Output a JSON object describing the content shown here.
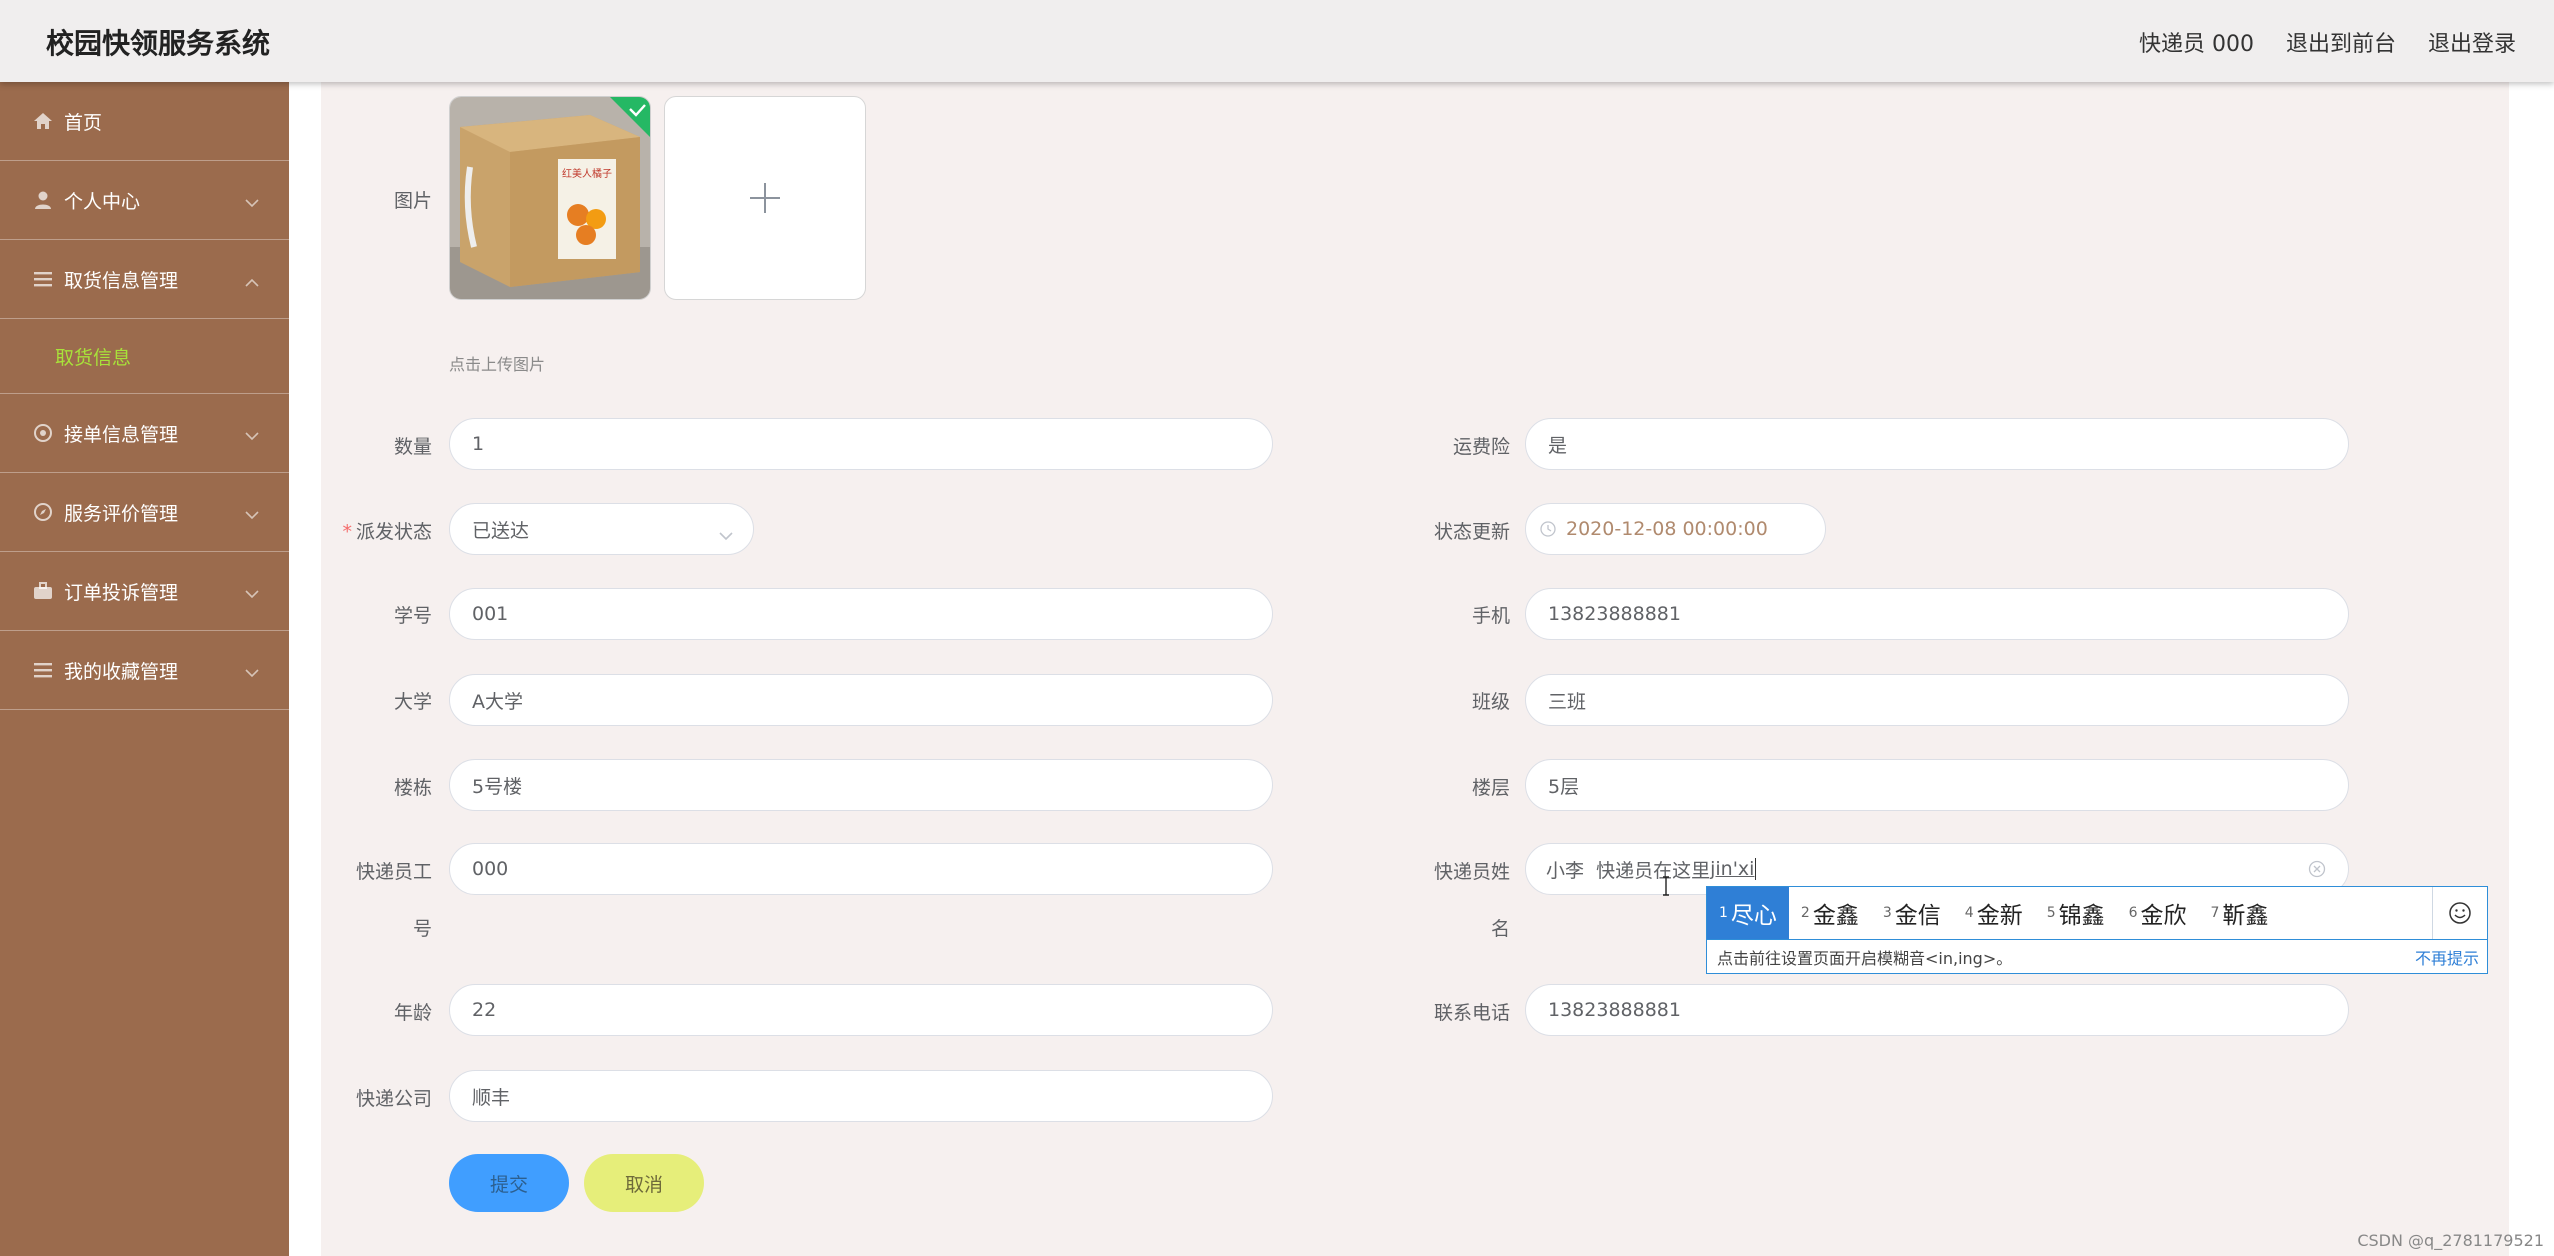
{
  "header": {
    "title": "校园快领服务系统",
    "user_label": "快递员 000",
    "to_front": "退出到前台",
    "logout": "退出登录"
  },
  "sidebar": {
    "items": [
      {
        "label": "首页",
        "icon": "home-icon",
        "expandable": false
      },
      {
        "label": "个人中心",
        "icon": "user-icon",
        "expandable": true
      },
      {
        "label": "取货信息管理",
        "icon": "menu-icon",
        "expandable": true,
        "expanded": true
      },
      {
        "label": "接单信息管理",
        "icon": "gear-icon",
        "expandable": true
      },
      {
        "label": "服务评价管理",
        "icon": "compass-icon",
        "expandable": true
      },
      {
        "label": "订单投诉管理",
        "icon": "briefcase-icon",
        "expandable": true
      },
      {
        "label": "我的收藏管理",
        "icon": "menu-icon",
        "expandable": true
      }
    ],
    "submenu_active": "取货信息",
    "active_color": "#a8e23a"
  },
  "form": {
    "image_label": "图片",
    "upload_tip": "点击上传图片",
    "fields": {
      "quantity": {
        "label": "数量",
        "value": "1"
      },
      "insurance": {
        "label": "运费险",
        "value": "是"
      },
      "status": {
        "label": "派发状态",
        "value": "已送达",
        "required": true
      },
      "status_update": {
        "label": "状态更新",
        "value": "2020-12-08 00:00:00"
      },
      "student_no": {
        "label": "学号",
        "value": "001"
      },
      "phone": {
        "label": "手机",
        "value": "13823888881"
      },
      "university": {
        "label": "大学",
        "value": "A大学"
      },
      "class": {
        "label": "班级",
        "value": "三班"
      },
      "building": {
        "label": "楼栋",
        "value": "5号楼"
      },
      "floor": {
        "label": "楼层",
        "value": "5层"
      },
      "courier_id": {
        "label_1": "快递员工",
        "label_2": "号",
        "value": "000"
      },
      "courier_name": {
        "label_1": "快递员姓",
        "label_2": "名",
        "value": "小李  快递员在这里",
        "composing": "jin'xi"
      },
      "age": {
        "label": "年龄",
        "value": "22"
      },
      "contact": {
        "label": "联系电话",
        "value": "13823888881"
      },
      "company": {
        "label": "快递公司",
        "value": "顺丰"
      }
    },
    "submit": "提交",
    "cancel": "取消"
  },
  "ime": {
    "candidates": [
      {
        "n": "1",
        "text": "尽心"
      },
      {
        "n": "2",
        "text": "金鑫"
      },
      {
        "n": "3",
        "text": "金信"
      },
      {
        "n": "4",
        "text": "金新"
      },
      {
        "n": "5",
        "text": "锦鑫"
      },
      {
        "n": "6",
        "text": "金欣"
      },
      {
        "n": "7",
        "text": "靳鑫"
      }
    ],
    "hint": "点击前往设置页面开启模糊音<in,ing>。",
    "no_hint": "不再提示"
  },
  "colors": {
    "sidebar_bg": "#9b6b4d",
    "submit_bg": "#409eff",
    "cancel_bg": "#e6ee7a",
    "ime_accent": "#2f7fd6"
  },
  "watermark": "CSDN @q_2781179521"
}
